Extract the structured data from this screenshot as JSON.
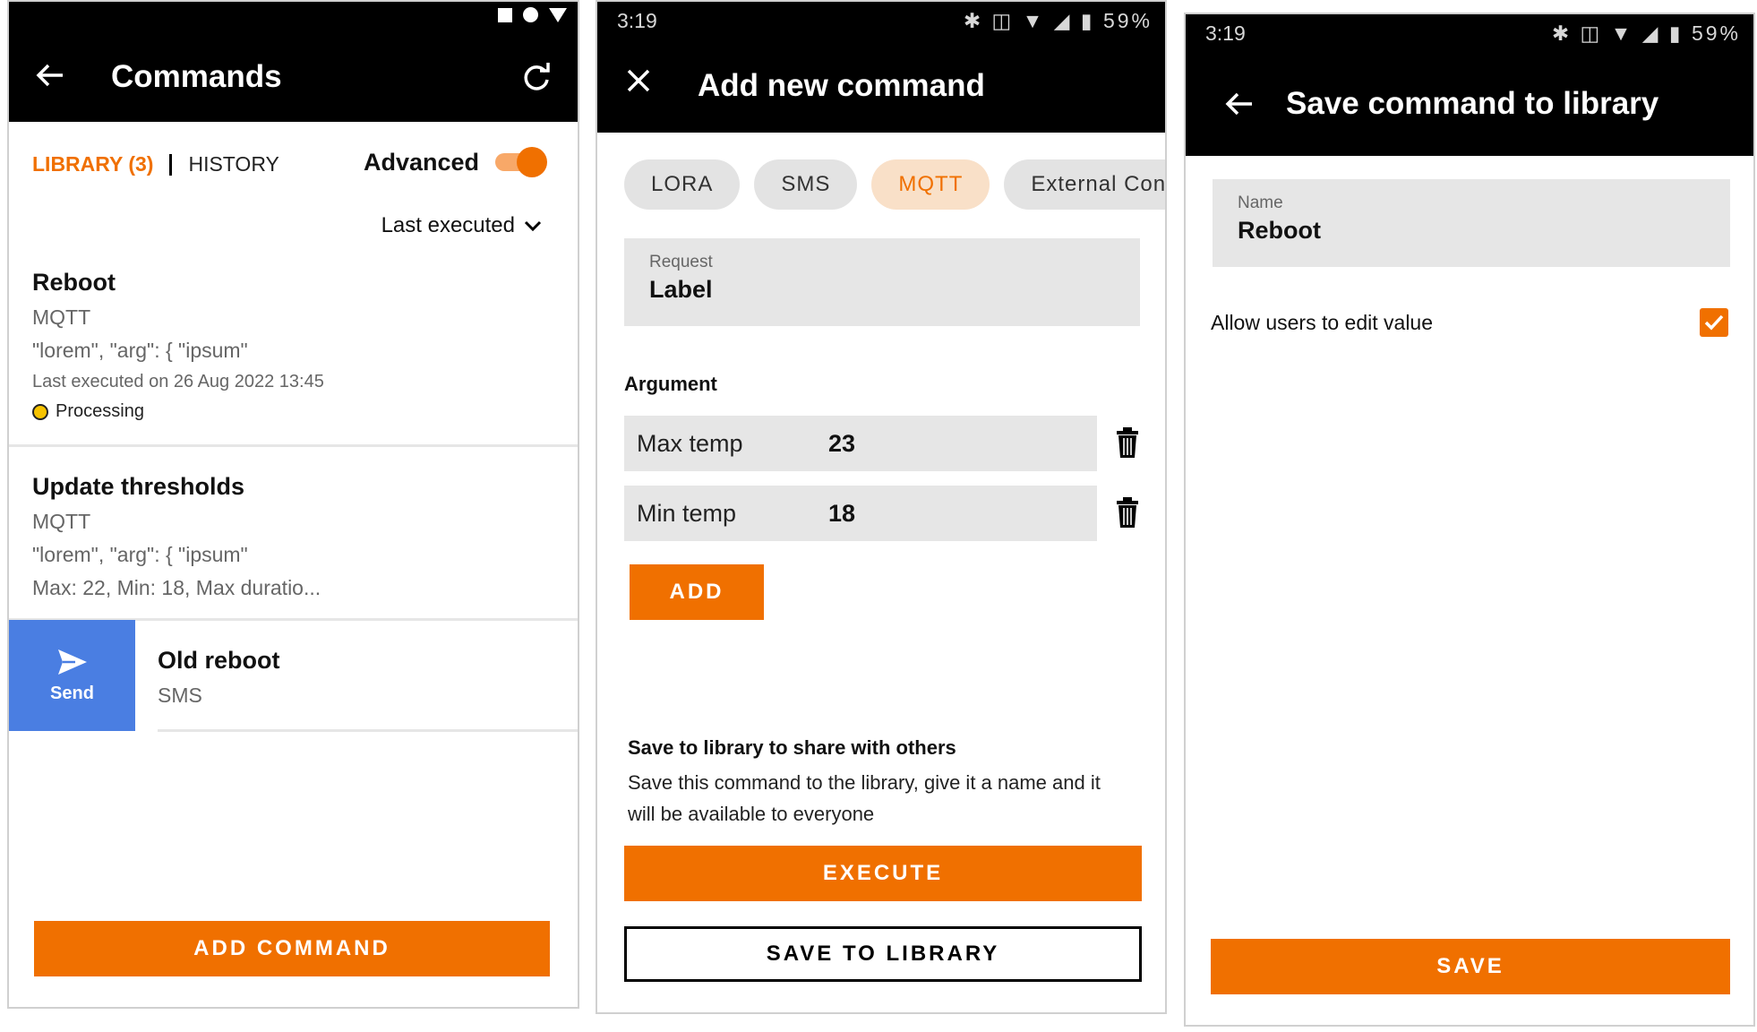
{
  "screen1": {
    "title": "Commands",
    "tab_library": "LIBRARY (3)",
    "tab_history": "HISTORY",
    "advanced_label": "Advanced",
    "sort_label": "Last executed",
    "commands": [
      {
        "name": "Reboot",
        "protocol": "MQTT",
        "payload": "\"lorem\", \"arg\": { \"ipsum\"",
        "last_executed": "Last executed on 26 Aug 2022 13:45",
        "status": "Processing"
      },
      {
        "name": "Update thresholds",
        "protocol": "MQTT",
        "payload": "\"lorem\", \"arg\": { \"ipsum\"",
        "detail": "Max: 22, Min: 18, Max duratio..."
      },
      {
        "name": "Old reboot",
        "protocol": "SMS"
      }
    ],
    "send_label": "Send",
    "add_command_label": "ADD COMMAND",
    "colors": {
      "accent": "#f07000",
      "send": "#4a7ee2",
      "status_processing": "#f7c300"
    }
  },
  "screen2": {
    "time": "3:19",
    "battery": "59%",
    "title": "Add new command",
    "chips": [
      "LORA",
      "SMS",
      "MQTT",
      "External Conn"
    ],
    "active_chip": "MQTT",
    "request_label": "Request",
    "request_value": "Label",
    "argument_heading": "Argument",
    "arguments": [
      {
        "key": "Max temp",
        "value": "23"
      },
      {
        "key": "Min temp",
        "value": "18"
      }
    ],
    "add_label": "ADD",
    "info_title": "Save to library to share with others",
    "info_body": "Save this command to the library, give it a name and it will be available to everyone",
    "execute_label": "EXECUTE",
    "save_to_library_label": "SAVE TO LIBRARY"
  },
  "screen3": {
    "time": "3:19",
    "battery": "59%",
    "title": "Save command to library",
    "name_label": "Name",
    "name_value": "Reboot",
    "allow_edit_label": "Allow users to edit value",
    "allow_edit_checked": true,
    "save_label": "SAVE"
  }
}
